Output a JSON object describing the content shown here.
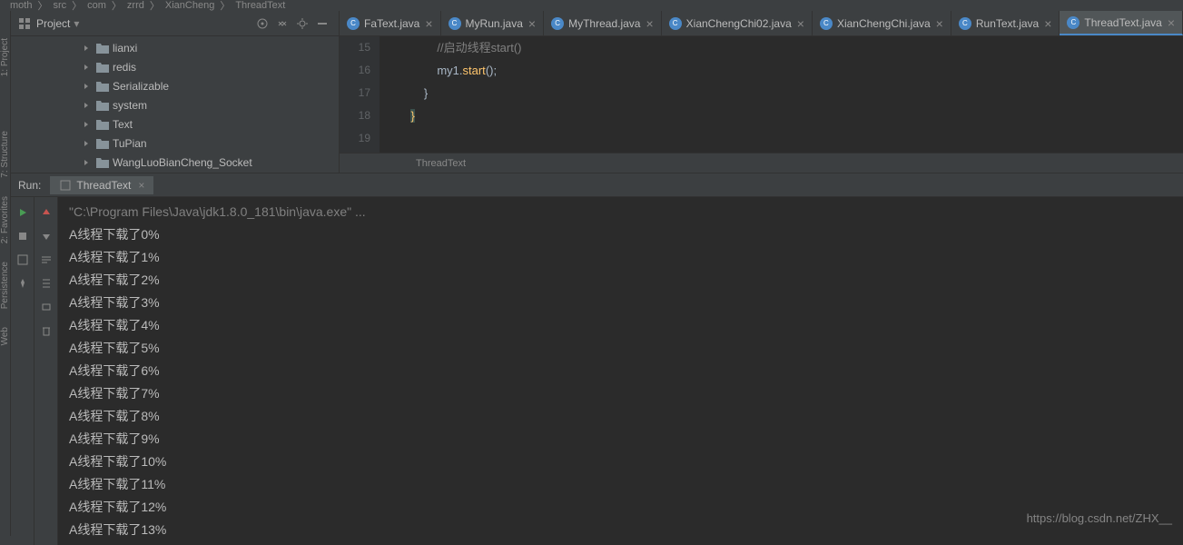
{
  "breadcrumb": [
    "moth",
    "src",
    "com",
    "zrrd",
    "XianCheng",
    "ThreadText"
  ],
  "project": {
    "title": "Project",
    "items": [
      {
        "label": "lianxi"
      },
      {
        "label": "redis"
      },
      {
        "label": "Serializable"
      },
      {
        "label": "system"
      },
      {
        "label": "Text"
      },
      {
        "label": "TuPian"
      },
      {
        "label": "WangLuoBianCheng_Socket"
      }
    ]
  },
  "editor": {
    "tabs": [
      {
        "label": "FaText.java"
      },
      {
        "label": "MyRun.java"
      },
      {
        "label": "MyThread.java"
      },
      {
        "label": "XianChengChi02.java"
      },
      {
        "label": "XianChengChi.java"
      },
      {
        "label": "RunText.java"
      },
      {
        "label": "ThreadText.java"
      }
    ],
    "active_tab": 6,
    "lines": {
      "15": {
        "indent": "            ",
        "comment": "//启动线程start()"
      },
      "16": {
        "indent": "            ",
        "code_prefix": "my1.",
        "method": "start",
        "code_suffix": "();"
      },
      "17": {
        "indent": "        ",
        "brace": "}"
      },
      "18": {
        "indent": "    ",
        "brace_hl": "}"
      },
      "19": {
        "indent": "",
        "text": ""
      }
    },
    "gutter": [
      "15",
      "16",
      "17",
      "18",
      "19"
    ],
    "breadcrumb_bottom": "ThreadText"
  },
  "run": {
    "title": "Run:",
    "tab_label": "ThreadText",
    "cmd": "\"C:\\Program Files\\Java\\jdk1.8.0_181\\bin\\java.exe\" ...",
    "output": [
      "A线程下载了0%",
      "A线程下载了1%",
      "A线程下载了2%",
      "A线程下载了3%",
      "A线程下载了4%",
      "A线程下载了5%",
      "A线程下载了6%",
      "A线程下载了7%",
      "A线程下载了8%",
      "A线程下载了9%",
      "A线程下载了10%",
      "A线程下载了11%",
      "A线程下载了12%",
      "A线程下载了13%"
    ]
  },
  "sidebars": {
    "left": [
      "1: Project",
      "7: Structure",
      "2: Favorites",
      "Persistence",
      "Web"
    ]
  },
  "watermark": "https://blog.csdn.net/ZHX__"
}
